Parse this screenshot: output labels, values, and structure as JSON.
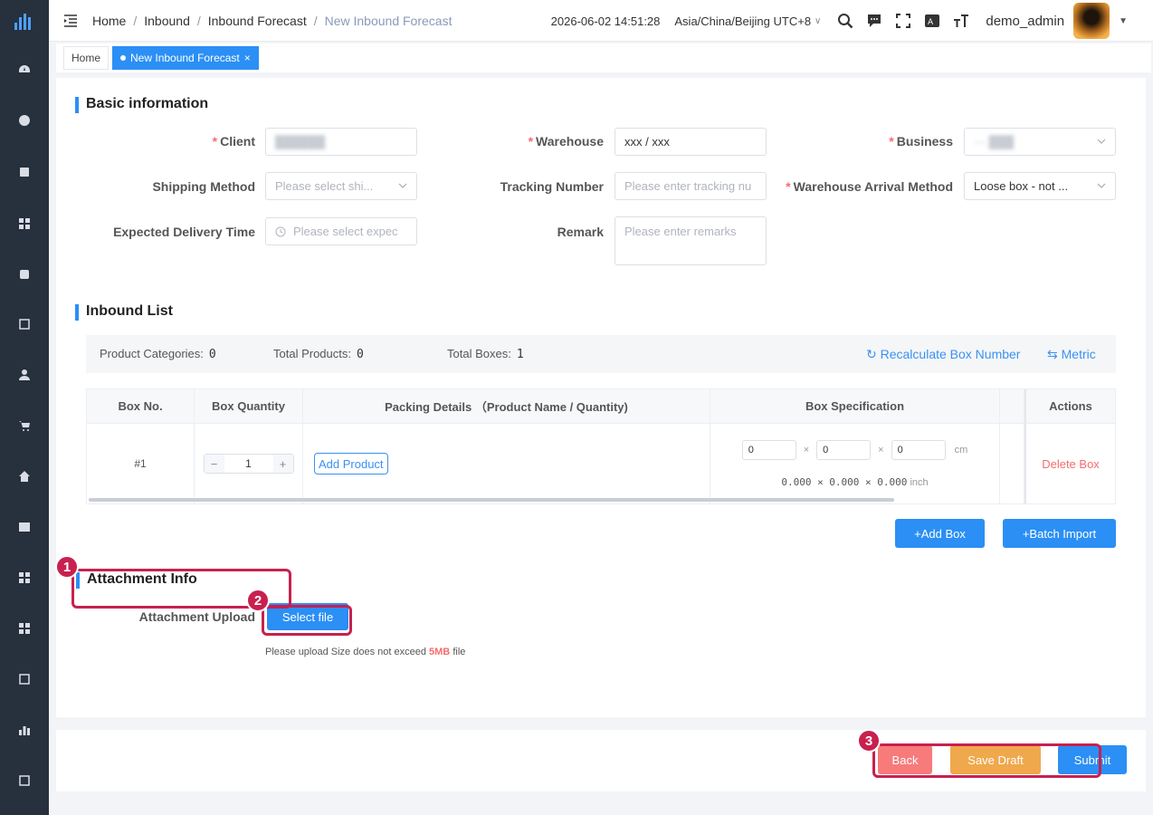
{
  "breadcrumb": [
    "Home",
    "Inbound",
    "Inbound Forecast",
    "New Inbound Forecast"
  ],
  "header": {
    "datetime": "2026-06-02 14:51:28",
    "timezone": "Asia/China/Beijing UTC+8",
    "username": "demo_admin"
  },
  "tags": {
    "home": "Home",
    "active": "New Inbound Forecast"
  },
  "basic": {
    "title": "Basic information",
    "client_label": "Client",
    "warehouse_label": "Warehouse",
    "warehouse_value": "xxx / xxx",
    "business_label": "Business",
    "shipping_label": "Shipping Method",
    "shipping_placeholder": "Please select shi...",
    "tracking_label": "Tracking Number",
    "tracking_placeholder": "Please enter tracking nu",
    "arrival_label": "Warehouse Arrival Method",
    "arrival_value": "Loose box - not ...",
    "delivery_label": "Expected Delivery Time",
    "delivery_placeholder": "Please select expec",
    "remark_label": "Remark",
    "remark_placeholder": "Please enter remarks"
  },
  "inbound": {
    "title": "Inbound List",
    "categories_label": "Product Categories:",
    "categories_value": "0",
    "products_label": "Total Products:",
    "products_value": "0",
    "boxes_label": "Total Boxes:",
    "boxes_value": "1",
    "recalc": "Recalculate Box Number",
    "metric": "Metric",
    "columns": {
      "box_no": "Box No.",
      "box_qty": "Box Quantity",
      "packing": "Packing Details （Product Name / Quantity)",
      "spec": "Box Specification",
      "actions": "Actions"
    },
    "row": {
      "box_no": "#1",
      "qty": "1",
      "add_product": "Add Product",
      "len": "0",
      "wid": "0",
      "hei": "0",
      "unit_cm": "cm",
      "inch_line": "0.000 × 0.000 × 0.000",
      "unit_inch": "inch",
      "delete": "Delete Box"
    },
    "add_box": "+Add Box",
    "batch_import": "+Batch Import"
  },
  "attachment": {
    "title": "Attachment Info",
    "upload_label": "Attachment Upload",
    "select_file": "Select file",
    "hint_prefix": "Please upload Size does not exceed",
    "hint_size": "5MB",
    "hint_suffix": "file"
  },
  "footer": {
    "back": "Back",
    "save_draft": "Save Draft",
    "submit": "Submit"
  },
  "annotations": [
    "1",
    "2",
    "3"
  ]
}
